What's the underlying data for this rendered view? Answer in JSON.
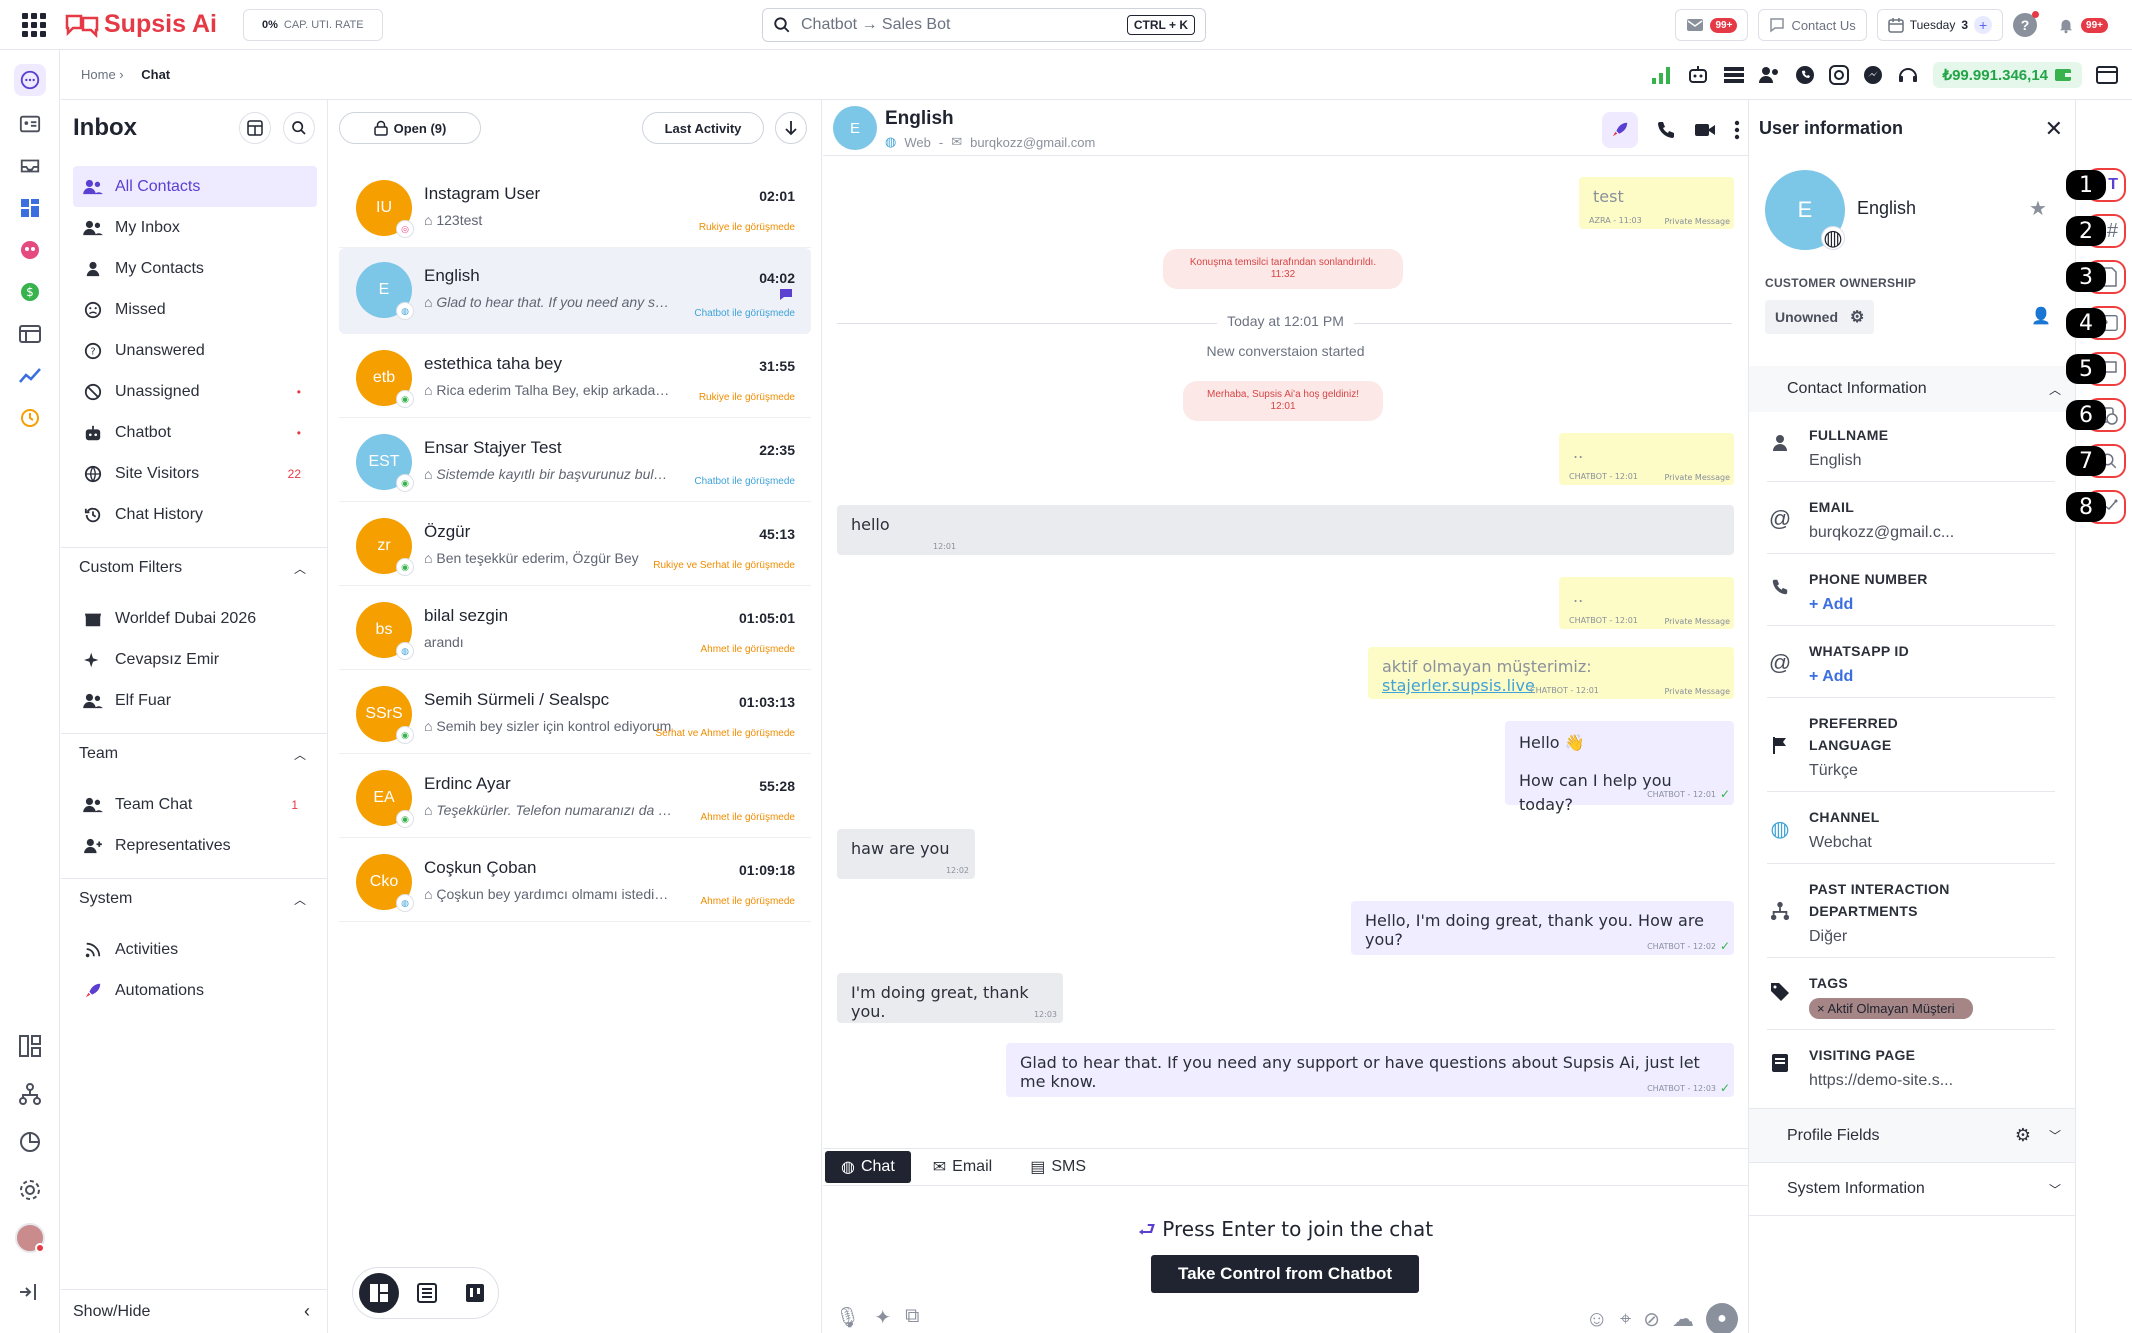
{
  "app": {
    "brand": "Supsis Ai",
    "cap_rate_value": "0%",
    "cap_rate_label": "CAP. UTI. RATE"
  },
  "search": {
    "text": "Chatbot → Sales Bot",
    "shortcut": "CTRL + K"
  },
  "topbar": {
    "mail_badge": "99+",
    "contact_us": "Contact Us",
    "day": "Tuesday",
    "date_num": "3",
    "notif_badge": "99+"
  },
  "breadcrumb": {
    "home": "Home ›",
    "current": "Chat"
  },
  "balance": "₺99.991.346,14",
  "inbox": {
    "title": "Inbox",
    "nav": [
      {
        "label": "All Contacts",
        "count": ""
      },
      {
        "label": "My Inbox",
        "count": ""
      },
      {
        "label": "My Contacts",
        "count": ""
      },
      {
        "label": "Missed",
        "count": ""
      },
      {
        "label": "Unanswered",
        "count": ""
      },
      {
        "label": "Unassigned",
        "count": "•"
      },
      {
        "label": "Chatbot",
        "count": "•"
      },
      {
        "label": "Site Visitors",
        "count": "22"
      },
      {
        "label": "Chat History",
        "count": ""
      }
    ],
    "custom_filters": {
      "title": "Custom Filters",
      "items": [
        "Worldef Dubai 2026",
        "Cevapsız Emir",
        "Elf Fuar"
      ]
    },
    "team": {
      "title": "Team",
      "items": [
        {
          "label": "Team Chat",
          "count": "1"
        },
        {
          "label": "Representatives",
          "count": ""
        }
      ]
    },
    "system": {
      "title": "System",
      "items": [
        "Activities",
        "Automations"
      ]
    },
    "show_hide": "Show/Hide"
  },
  "list": {
    "open_label": "Open (9)",
    "sort_label": "Last Activity",
    "conversations": [
      {
        "initials": "IU",
        "name": "Instagram User",
        "msg": "123test",
        "time": "02:01",
        "status": "Rukiye ile görüşmede",
        "color": "#f59f00",
        "status_color": "orange"
      },
      {
        "initials": "E",
        "name": "English",
        "msg": "Glad to hear that. If you need any support or have questions",
        "time": "04:02",
        "status": "Chatbot ile görüşmede",
        "color": "#7cc6e8",
        "status_color": "blue"
      },
      {
        "initials": "etb",
        "name": "estethica taha bey",
        "msg": "Rica ederim Talha Bey, ekip arkadaşlarımız",
        "time": "31:55",
        "status": "Rukiye ile görüşmede",
        "color": "#f59f00",
        "status_color": "orange"
      },
      {
        "initials": "EST",
        "name": "Ensar Stajyer Test",
        "msg": "Sistemde kayıtlı bir başvurunuz bulunmaktadır",
        "time": "22:35",
        "status": "Chatbot ile görüşmede",
        "color": "#7cc6e8",
        "status_color": "blue"
      },
      {
        "initials": "zr",
        "name": "Özgür",
        "msg": "Ben teşekkür ederim, Özgür Bey",
        "time": "45:13",
        "status": "Rukiye ve Serhat ile görüşmede",
        "color": "#f59f00",
        "status_color": "orange"
      },
      {
        "initials": "bs",
        "name": "bilal sezgin",
        "msg": "arandı",
        "time": "01:05:01",
        "status": "Ahmet ile görüşmede",
        "color": "#f59f00",
        "status_color": "orange"
      },
      {
        "initials": "SSrS",
        "name": "Semih Sürmeli / Sealspc",
        "msg": "Semih bey sizler için kontrol ediyorum",
        "time": "01:03:13",
        "status": "Serhat ve Ahmet ile görüşmede",
        "color": "#f59f00",
        "status_color": "orange"
      },
      {
        "initials": "EA",
        "name": "Erdinc Ayar",
        "msg": "Teşekkürler. Telefon numaranızı da alabilir miyim",
        "time": "55:28",
        "status": "Ahmet ile görüşmede",
        "color": "#f59f00",
        "status_color": "orange"
      },
      {
        "initials": "Cko",
        "name": "Coşkun Çoban",
        "msg": "Çoşkun bey yardımcı olmamı istediğiniz",
        "time": "01:09:18",
        "status": "Ahmet ile görüşmede",
        "color": "#f59f00",
        "status_color": "orange"
      }
    ]
  },
  "chat": {
    "initial": "E",
    "name": "English",
    "channel": "Web",
    "email": "burqkozz@gmail.com",
    "messages": {
      "m1": {
        "text": "test",
        "meta": "AZRA - 11:03",
        "pm": "Private Message"
      },
      "sys1": {
        "text": "Konuşma temsilci tarafından sonlandırıldı.",
        "time": "11:32"
      },
      "divider": "Today at 12:01 PM",
      "started": "New converstaion started",
      "sys2": {
        "text": "Merhaba, Supsis Ai'a hoş geldiniz!",
        "time": "12:01"
      },
      "m2": {
        "text": "..",
        "meta": "CHATBOT - 12:01",
        "pm": "Private Message"
      },
      "m3": {
        "text": "hello",
        "meta": "12:01"
      },
      "m4": {
        "text": "..",
        "meta": "CHATBOT - 12:01",
        "pm": "Private Message"
      },
      "m5": {
        "text": "aktif olmayan müşterimiz:",
        "link": "stajerler.supsis.live",
        "meta": "CHATBOT - 12:01",
        "pm": "Private Message"
      },
      "m6": {
        "line1": "Hello 👋",
        "line2": "How can I help you today?",
        "meta": "CHATBOT - 12:01"
      },
      "m7": {
        "text": "haw are you",
        "meta": "12:02"
      },
      "m8": {
        "text": "Hello, I'm doing great, thank you. How are you?",
        "meta": "CHATBOT - 12:02"
      },
      "m9": {
        "text": "I'm doing great, thank you.",
        "meta": "12:03"
      },
      "m10": {
        "text": "Glad to hear that. If you need any support or have questions about Supsis Ai, just let me know.",
        "meta": "CHATBOT - 12:03"
      }
    },
    "tabs": [
      "Chat",
      "Email",
      "SMS"
    ],
    "press_enter": "Press Enter to join the chat",
    "take_control": "Take Control from Chatbot"
  },
  "user_info": {
    "title": "User information",
    "initial": "E",
    "name": "English",
    "ownership_label": "CUSTOMER OWNERSHIP",
    "ownership_value": "Unowned",
    "contact_info": "Contact Information",
    "fields": {
      "fullname": {
        "label": "FULLNAME",
        "value": "English"
      },
      "email": {
        "label": "EMAIL",
        "value": "burqkozz@gmail.c..."
      },
      "phone": {
        "label": "PHONE NUMBER",
        "value": "+ Add"
      },
      "whatsapp": {
        "label": "WHATSAPP ID",
        "value": "+ Add"
      },
      "language": {
        "label1": "PREFERRED",
        "label2": "LANGUAGE",
        "value": "Türkçe"
      },
      "channel": {
        "label": "CHANNEL",
        "value": "Webchat"
      },
      "departments": {
        "label1": "PAST INTERACTION",
        "label2": "DEPARTMENTS",
        "value": "Diğer"
      },
      "tags": {
        "label": "TAGS",
        "value": "Aktif Olmayan Müşteri"
      },
      "visiting": {
        "label": "VISITING PAGE",
        "value": "https://demo-site.s..."
      }
    },
    "profile_fields": "Profile Fields",
    "system_information": "System Information"
  },
  "strip_numbers": [
    "1",
    "2",
    "3",
    "4",
    "5",
    "6",
    "7",
    "8"
  ],
  "colors": {
    "accent": "#5b3fd1",
    "brand": "#e63946",
    "orange": "#f59f00",
    "blue": "#7cc6e8"
  }
}
